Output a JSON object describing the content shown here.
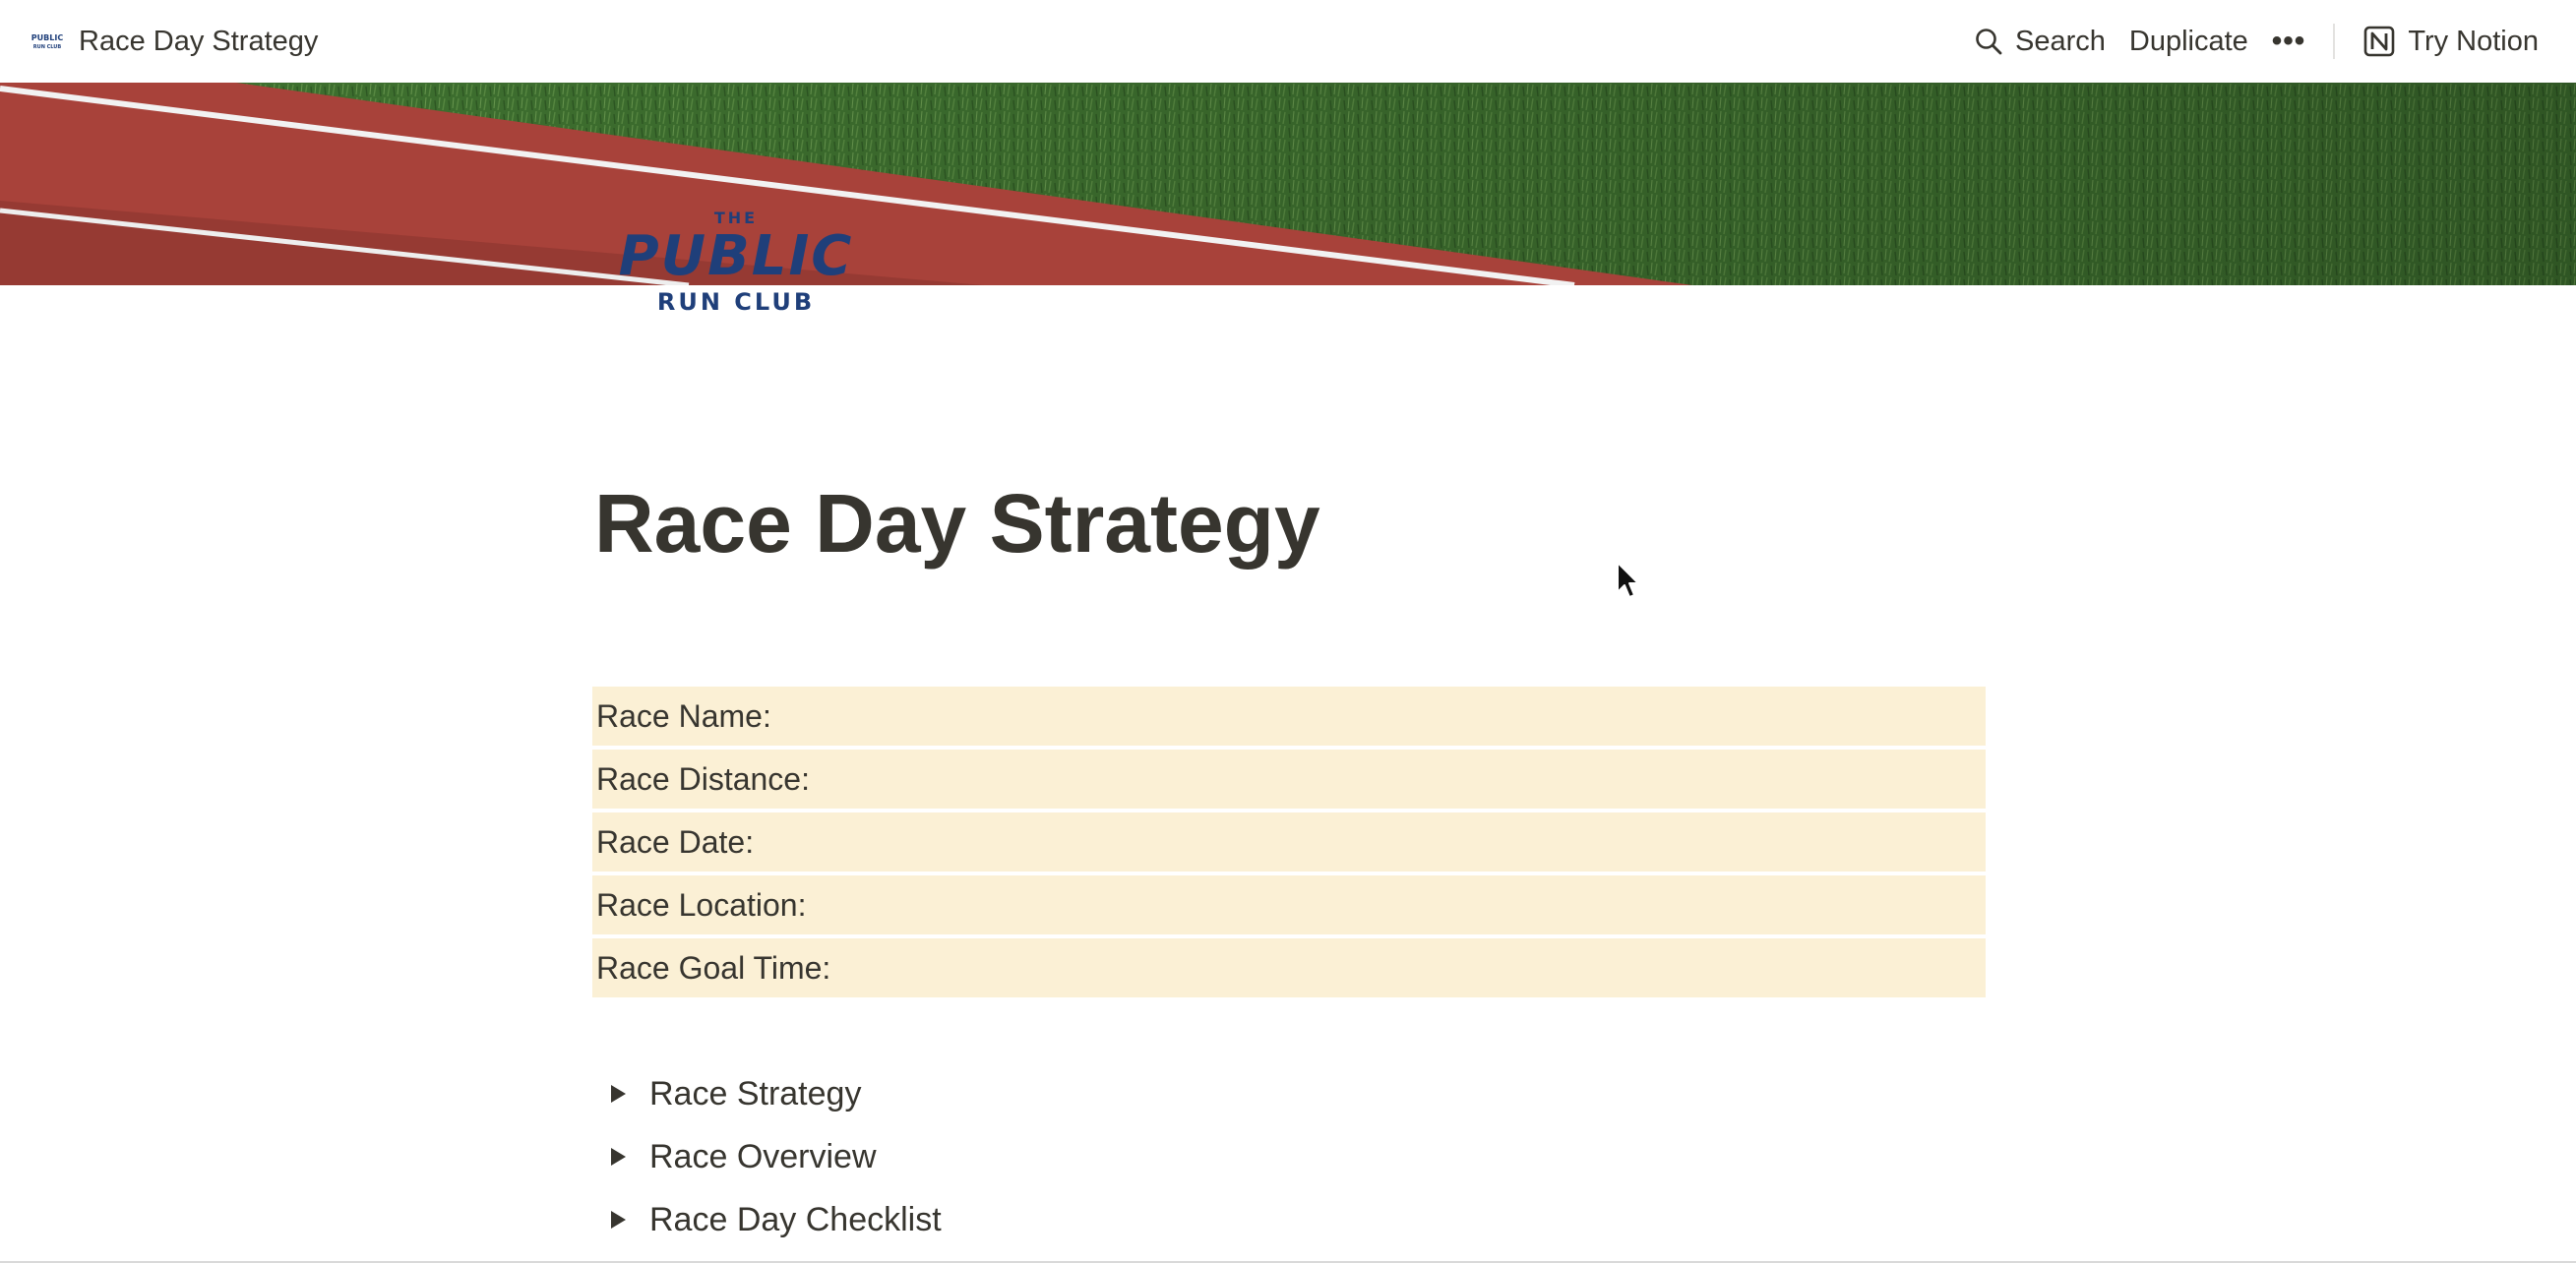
{
  "topbar": {
    "page_title": "Race Day Strategy",
    "search_label": "Search",
    "duplicate_label": "Duplicate",
    "more_label": "•••",
    "try_notion_label": "Try Notion",
    "favicon_icon": "public-run-club-favicon",
    "search_icon": "search-icon",
    "notion_icon": "notion-logo-icon"
  },
  "cover": {
    "description_icon": "running-track-cover-image"
  },
  "logo": {
    "the": "THE",
    "public": "PUBLIC",
    "run_club": "RUN CLUB",
    "color": "#1f3f7a"
  },
  "page": {
    "title": "Race Day Strategy"
  },
  "info_rows": [
    {
      "label": "Race Name:"
    },
    {
      "label": "Race Distance:"
    },
    {
      "label": "Race Date:"
    },
    {
      "label": "Race Location:"
    },
    {
      "label": "Race Goal Time:"
    }
  ],
  "toggles": [
    {
      "label": "Race Strategy"
    },
    {
      "label": "Race Overview"
    },
    {
      "label": "Race Day Checklist"
    }
  ],
  "colors": {
    "callout_bg": "#fbf0d5",
    "text": "#37352f",
    "track_red": "#a8423a",
    "grass_green": "#3e6f2d"
  }
}
